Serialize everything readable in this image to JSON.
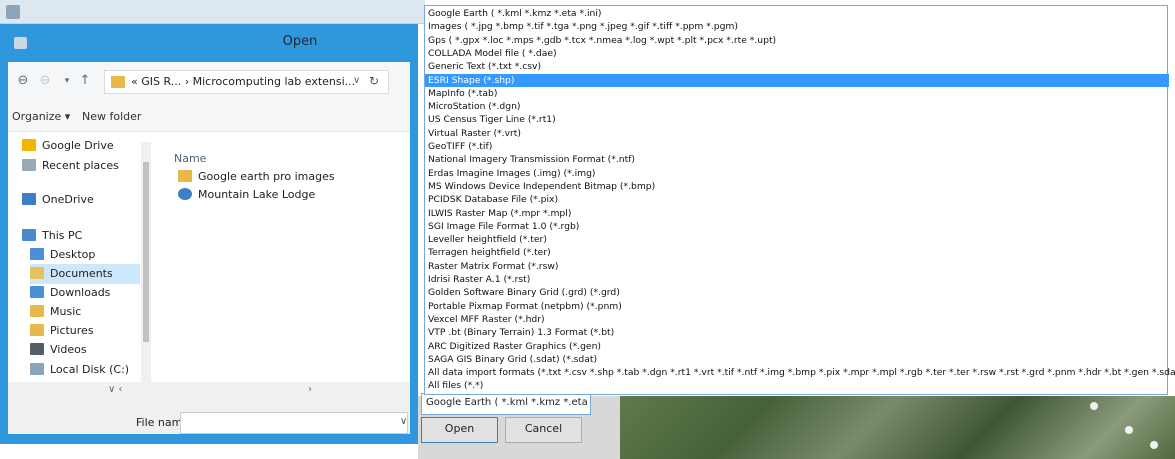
{
  "dialog": {
    "title": "Open"
  },
  "address": {
    "path": "« GIS R... › Microcomputing lab extensi..."
  },
  "toolbar": {
    "organize": "Organize ▾",
    "new_folder": "New folder"
  },
  "nav": {
    "items": [
      {
        "label": "Google Drive",
        "icon": "google-drive-icon",
        "color": "#f4b400"
      },
      {
        "label": "Recent places",
        "icon": "recent-places-icon",
        "color": "#9aa9b6"
      },
      {
        "label": "OneDrive",
        "icon": "onedrive-icon",
        "color": "#3c7fc4"
      },
      {
        "label": "This PC",
        "icon": "computer-icon",
        "color": "#4b89c8"
      },
      {
        "label": "Desktop",
        "icon": "desktop-icon",
        "color": "#4a90d9"
      },
      {
        "label": "Documents",
        "icon": "documents-icon",
        "color": "#e8c15a"
      },
      {
        "label": "Downloads",
        "icon": "downloads-icon",
        "color": "#4a90d9"
      },
      {
        "label": "Music",
        "icon": "music-icon",
        "color": "#e8b84a"
      },
      {
        "label": "Pictures",
        "icon": "pictures-icon",
        "color": "#e8b84a"
      },
      {
        "label": "Videos",
        "icon": "videos-icon",
        "color": "#555e66"
      },
      {
        "label": "Local Disk (C:)",
        "icon": "disk-icon",
        "color": "#8aa4bb"
      }
    ]
  },
  "content": {
    "column_header": "Name",
    "files": [
      {
        "label": "Google earth pro images",
        "icon": "folder-icon",
        "color": "#e8b84a"
      },
      {
        "label": "Mountain Lake Lodge",
        "icon": "kml-file-icon",
        "color": "#3c7fc4"
      }
    ]
  },
  "bottom": {
    "file_name_label": "File name:",
    "file_name_value": "",
    "filter_value": "Google Earth ( *.kml *.kmz *.eta ▾",
    "open_button": "Open",
    "cancel_button": "Cancel"
  },
  "filter_options": [
    "Google Earth ( *.kml *.kmz *.eta *.ini)",
    "Images ( *.jpg *.bmp *.tif *.tga *.png *.jpeg *.gif *.tiff *.ppm *.pgm)",
    "Gps ( *.gpx *.loc *.mps *.gdb *.tcx *.nmea *.log *.wpt *.plt *.pcx *.rte *.upt)",
    "COLLADA Model file ( *.dae)",
    "Generic Text (*.txt *.csv)",
    "ESRI Shape (*.shp)",
    "MapInfo (*.tab)",
    "MicroStation (*.dgn)",
    "US Census Tiger Line (*.rt1)",
    "Virtual Raster (*.vrt)",
    "GeoTIFF (*.tif)",
    "National Imagery Transmission Format (*.ntf)",
    "Erdas Imagine Images (.img) (*.img)",
    "MS Windows Device Independent Bitmap (*.bmp)",
    "PCIDSK Database File (*.pix)",
    "ILWIS Raster Map (*.mpr *.mpl)",
    "SGI Image File Format 1.0 (*.rgb)",
    "Leveller heightfield (*.ter)",
    "Terragen heightfield (*.ter)",
    "Raster Matrix Format (*.rsw)",
    "Idrisi Raster A.1 (*.rst)",
    "Golden Software Binary Grid (.grd) (*.grd)",
    "Portable Pixmap Format (netpbm) (*.pnm)",
    "Vexcel MFF Raster (*.hdr)",
    "VTP .bt (Binary Terrain) 1.3 Format (*.bt)",
    "ARC Digitized Raster Graphics (*.gen)",
    "SAGA GIS Binary Grid (.sdat) (*.sdat)",
    "All data import formats (*.txt *.csv *.shp *.tab *.dgn *.rt1 *.vrt *.tif *.ntf *.img *.bmp *.pix *.mpr *.mpl *.rgb *.ter *.ter *.rsw *.rst *.grd *.pnm *.hdr *.bt *.gen *.sdat",
    "All files (*.*)"
  ],
  "selected_option_index": 5,
  "colors": {
    "dialog_frame": "#2f98dd",
    "selection": "#3399ff"
  }
}
